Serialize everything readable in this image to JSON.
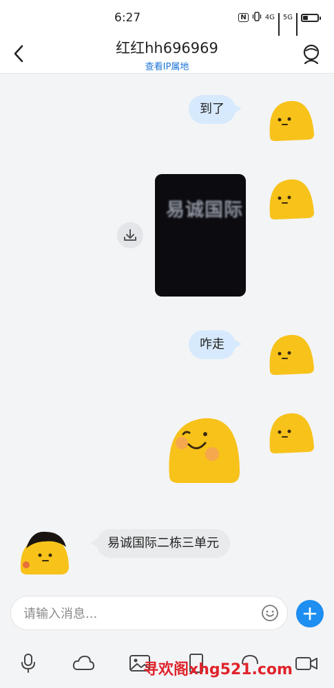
{
  "status_bar": {
    "time": "6:27",
    "nfc": "N",
    "net1": "4G",
    "net2": "5G",
    "battery_level": 0.35
  },
  "header": {
    "title": "红红hh696969",
    "subtitle": "查看IP属地"
  },
  "messages": [
    {
      "side": "sent",
      "type": "text",
      "text": "到了"
    },
    {
      "side": "sent",
      "type": "video",
      "thumbnail_text": "易诚国际"
    },
    {
      "side": "sent",
      "type": "text",
      "text": "咋走"
    },
    {
      "side": "sent",
      "type": "sticker",
      "sticker": "smiling-blob-sticker"
    },
    {
      "side": "received",
      "type": "text",
      "text": "易诚国际二栋三单元"
    }
  ],
  "input": {
    "placeholder": "请输入消息..."
  },
  "toolbar": {
    "tools": [
      "microphone-icon",
      "cloud-icon",
      "image-icon",
      "file-icon",
      "call-icon",
      "video-icon"
    ]
  },
  "watermark": "寻欢阁xhg521.com",
  "colors": {
    "accent": "#1e8ef0",
    "link": "#1a74d6",
    "sent_bubble": "#d7eafd",
    "received_bubble": "#e9eaec",
    "avatar_yellow": "#f7c21a",
    "watermark": "#e0232b"
  }
}
